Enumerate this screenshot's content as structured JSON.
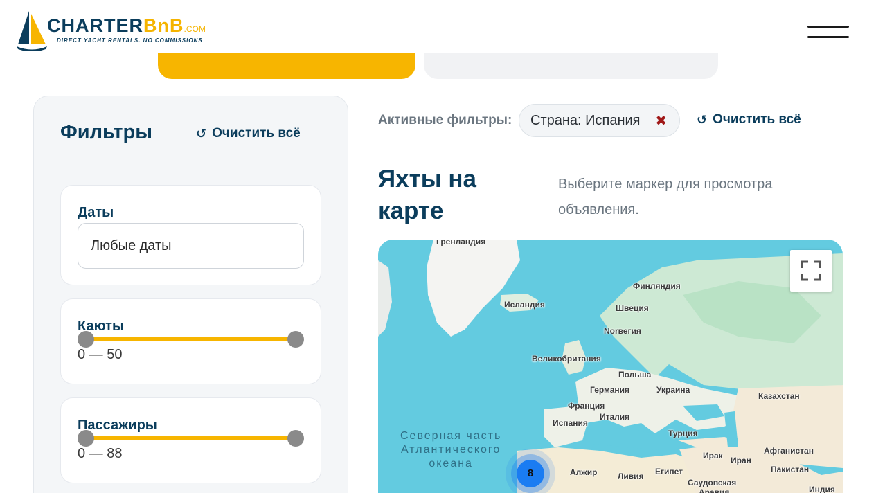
{
  "header": {
    "logo_main": "CHARTER",
    "logo_accent": "BnB",
    "logo_domain": ".COM",
    "logo_tagline": "DIRECT YACHT RENTALS.  NO COMMISSIONS",
    "brand_colors": {
      "navy": "#0b3d5c",
      "yellow": "#f7b500"
    }
  },
  "sidebar": {
    "title": "Фильтры",
    "clear_all": "Очистить всё",
    "dates": {
      "label": "Даты",
      "value": "Любые даты"
    },
    "cabins": {
      "label": "Каюты",
      "value": "0 — 50",
      "min": 0,
      "max": 50
    },
    "passengers": {
      "label": "Пассажиры",
      "value": "0 — 88",
      "min": 0,
      "max": 88
    }
  },
  "main": {
    "active_filters_label": "Активные фильтры:",
    "chip": {
      "key": "Страна:",
      "value": "Испания"
    },
    "clear_all": "Очистить всё",
    "map_title_line1": "Яхты на",
    "map_title_line2": "карте",
    "map_hint": "Выберите маркер для просмотра объявления."
  },
  "map": {
    "labels": {
      "greenland": "Гренландия",
      "iceland": "Исландия",
      "finland": "Финляндия",
      "sweden": "Швеция",
      "norway": "Norвегия",
      "uk": "Великобритания",
      "poland": "Польша",
      "germany": "Германия",
      "ukraine": "Украина",
      "kazakhstan": "Казахстан",
      "france": "Франция",
      "italy": "Италия",
      "spain": "Испания",
      "turkey": "Турция",
      "iraq": "Ирак",
      "iran": "Иран",
      "afghanistan": "Афганистан",
      "algeria": "Алжир",
      "libya": "Ливия",
      "egypt": "Египет",
      "pakistan": "Пакистан",
      "saudi": "Саудовская",
      "saudi2": "Аравия",
      "india": "Индия"
    },
    "ocean_line1": "Северная часть",
    "ocean_line2": "Атлантического",
    "ocean_line3": "океана",
    "cluster_count": "8"
  }
}
